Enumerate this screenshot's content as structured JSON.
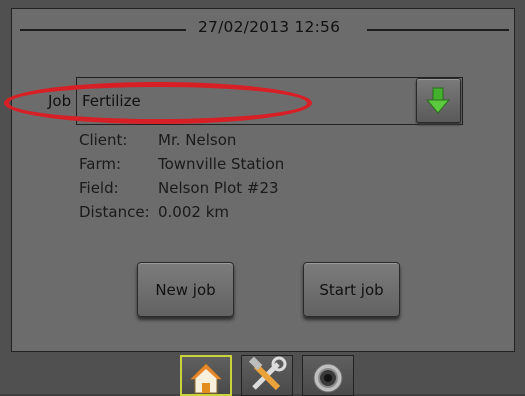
{
  "header": {
    "datetime": "27/02/2013 12:56"
  },
  "job": {
    "label": "Job",
    "value": "Fertilize",
    "dropdown_icon": "green-down-arrow-icon"
  },
  "details": [
    {
      "label": "Client:",
      "value": "Mr. Nelson"
    },
    {
      "label": "Farm:",
      "value": "Townville Station"
    },
    {
      "label": "Field:",
      "value": "Nelson Plot #23"
    },
    {
      "label": "Distance:",
      "value": "0.002 km"
    }
  ],
  "buttons": {
    "new_job": "New job",
    "start_job": "Start job"
  },
  "tabs": [
    {
      "name": "home",
      "icon": "home-icon",
      "active": true
    },
    {
      "name": "tools",
      "icon": "tools-icon",
      "active": false
    },
    {
      "name": "camera",
      "icon": "camera-icon",
      "active": false
    }
  ],
  "colors": {
    "highlight": "#d71f25",
    "accent_green": "#3fa82a",
    "active_tab_border": "#c9d33a"
  }
}
